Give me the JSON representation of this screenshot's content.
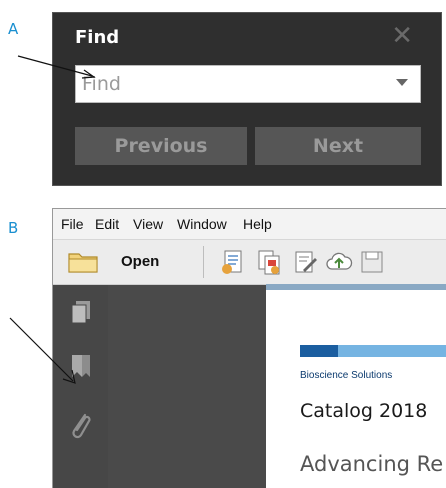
{
  "panel_a": {
    "label": "A",
    "dialog": {
      "title": "Find",
      "close_icon": "close-icon",
      "input_placeholder": "Find",
      "dropdown_icon": "chevron-down-icon",
      "previous_label": "Previous",
      "next_label": "Next"
    }
  },
  "panel_b": {
    "label": "B",
    "menu": [
      "File",
      "Edit",
      "View",
      "Window",
      "Help"
    ],
    "toolbar": {
      "open_label": "Open",
      "icons": [
        "folder-icon",
        "create-pdf-icon",
        "combine-files-icon",
        "edit-icon",
        "cloud-upload-icon",
        "save-icon"
      ]
    },
    "sidebar_icons": [
      "page-thumbnails-icon",
      "bookmarks-icon",
      "attachments-icon"
    ],
    "document": {
      "brand": "Bioscience Solutions",
      "title": "Catalog 2018",
      "subtitle": "Advancing Re"
    }
  },
  "colors": {
    "label_blue": "#1a8fd0",
    "dark_blue": "#1b5ea0",
    "light_blue": "#75b4e2"
  }
}
